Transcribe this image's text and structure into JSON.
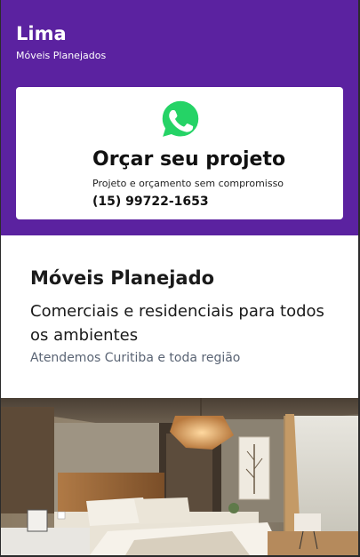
{
  "header": {
    "title": "Lima",
    "subtitle": "Móveis Planejados"
  },
  "cta_card": {
    "icon": "whatsapp-icon",
    "title": "Orçar seu projeto",
    "subtitle": "Projeto e orçamento sem compromisso",
    "phone": "(15) 99722-1653"
  },
  "info": {
    "title": "Móveis Planejado",
    "description": "Comerciais e residenciais para todos os ambientes",
    "region": "Atendemos Curitiba e toda região"
  },
  "colors": {
    "brand_purple": "#5b22a0",
    "whatsapp_green": "#25d366",
    "region_text": "#5a6474"
  }
}
